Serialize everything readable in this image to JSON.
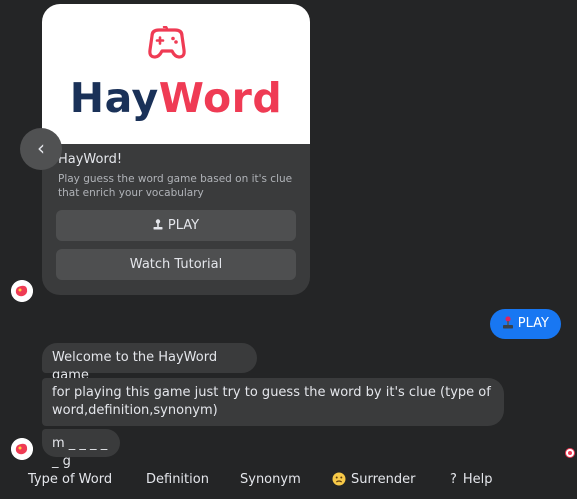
{
  "card": {
    "brand_hay": "Hay",
    "brand_word": "Word",
    "title": "HayWord!",
    "subtitle": "Play guess the word game based on it's clue that enrich your vocabulary",
    "play_icon": "joystick-icon",
    "play_label": "PLAY",
    "tutorial_label": "Watch Tutorial"
  },
  "sent": {
    "icon": "joystick-emoji",
    "label": "PLAY"
  },
  "messages": [
    "Welcome to the HayWord game",
    "for playing this game just try to guess the word by it's clue (type of word,definition,synonym)",
    "m _ _ _ _ _ g"
  ],
  "quick_replies": [
    {
      "label": "Type of Word"
    },
    {
      "label": "Definition"
    },
    {
      "label": "Synonym"
    },
    {
      "label": "Surrender",
      "icon": "sad-face-emoji"
    },
    {
      "label": "Help",
      "prefix": "?"
    }
  ],
  "colors": {
    "background": "#242526",
    "bubble": "#3a3b3c",
    "sent_bubble": "#1877f2",
    "brand_navy": "#1a3158",
    "brand_red": "#ef3b54"
  }
}
